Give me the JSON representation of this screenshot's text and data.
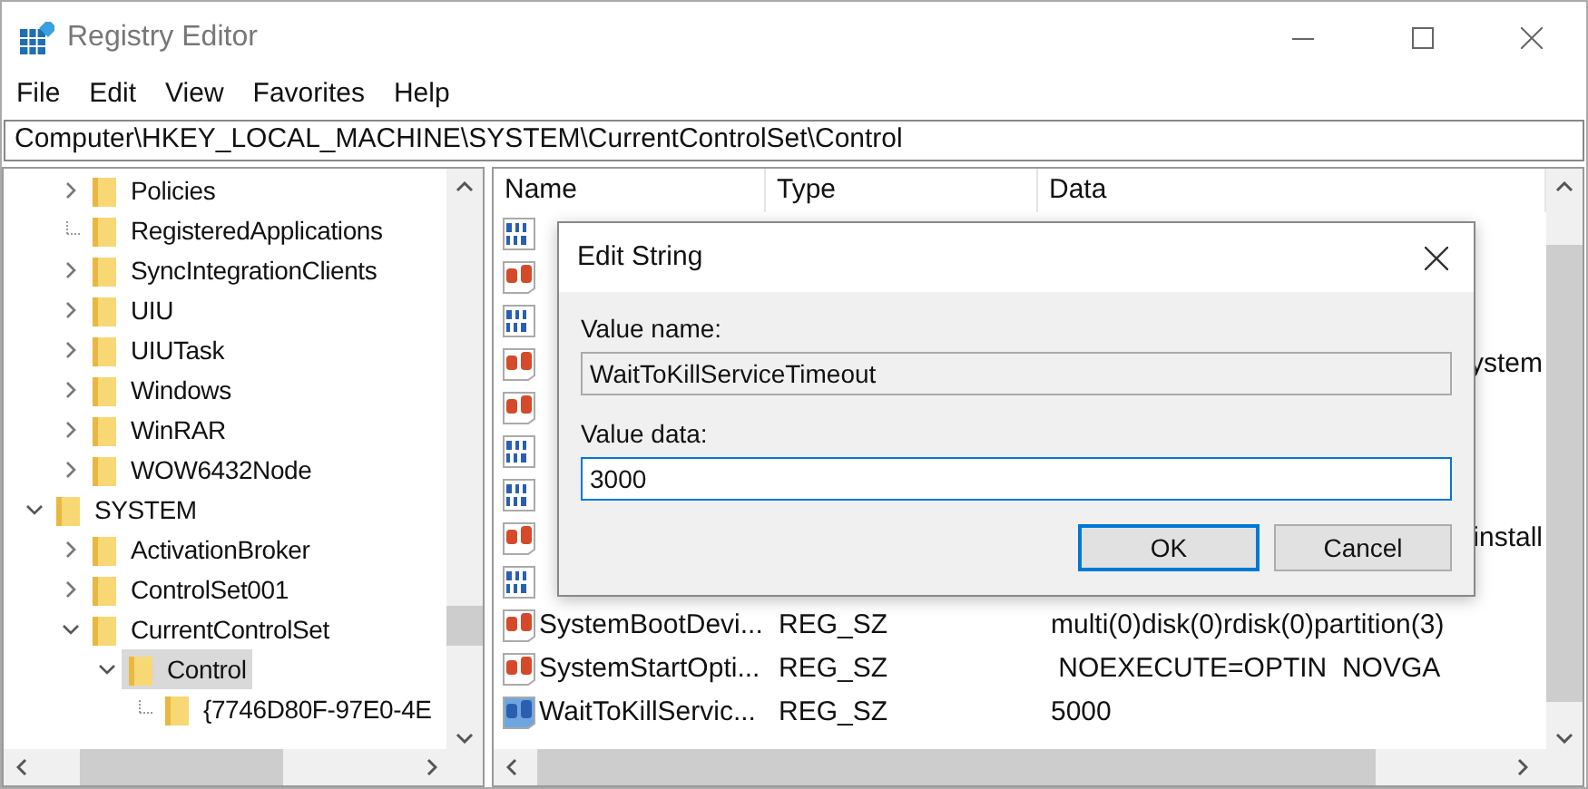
{
  "window": {
    "title": "Registry Editor"
  },
  "menu": [
    "File",
    "Edit",
    "View",
    "Favorites",
    "Help"
  ],
  "address": "Computer\\HKEY_LOCAL_MACHINE\\SYSTEM\\CurrentControlSet\\Control",
  "tree": {
    "continued_children": [
      {
        "label": "Policies",
        "has_children": true,
        "expanded": false,
        "selected": false
      },
      {
        "label": "RegisteredApplications",
        "has_children": false,
        "selected": false
      },
      {
        "label": "SyncIntegrationClients",
        "has_children": true,
        "expanded": false,
        "selected": false
      },
      {
        "label": "UIU",
        "has_children": true,
        "expanded": false,
        "selected": false
      },
      {
        "label": "UIUTask",
        "has_children": true,
        "expanded": false,
        "selected": false
      },
      {
        "label": "Windows",
        "has_children": true,
        "expanded": false,
        "selected": false
      },
      {
        "label": "WinRAR",
        "has_children": true,
        "expanded": false,
        "selected": false
      },
      {
        "label": "WOW6432Node",
        "has_children": true,
        "expanded": false,
        "selected": false
      }
    ],
    "nodes": [
      {
        "label": "SYSTEM",
        "has_children": true,
        "expanded": true,
        "selected": false,
        "children": [
          {
            "label": "ActivationBroker",
            "has_children": true,
            "expanded": false,
            "selected": false
          },
          {
            "label": "ControlSet001",
            "has_children": true,
            "expanded": false,
            "selected": false
          },
          {
            "label": "CurrentControlSet",
            "has_children": true,
            "expanded": true,
            "selected": false,
            "children": [
              {
                "label": "Control",
                "has_children": true,
                "expanded": true,
                "selected": true,
                "children": [
                  {
                    "label": "{7746D80F-97E0-4E",
                    "has_children": false,
                    "selected": false
                  }
                ]
              }
            ]
          }
        ]
      }
    ]
  },
  "list": {
    "columns": [
      "Name",
      "Type",
      "Data"
    ],
    "rows": [
      {
        "kind": "binary",
        "selected": false
      },
      {
        "kind": "string",
        "selected": false
      },
      {
        "kind": "binary",
        "selected": false
      },
      {
        "kind": "string",
        "selected": false,
        "data_tail": "ystem"
      },
      {
        "kind": "string",
        "selected": false
      },
      {
        "kind": "binary",
        "selected": false
      },
      {
        "kind": "binary",
        "selected": false
      },
      {
        "kind": "string",
        "selected": false,
        "data_tail": "install"
      },
      {
        "kind": "binary",
        "selected": false
      },
      {
        "kind": "string",
        "selected": false,
        "name": "SystemBootDevi...",
        "type": "REG_SZ",
        "data": "multi(0)disk(0)rdisk(0)partition(3)"
      },
      {
        "kind": "string",
        "selected": false,
        "name": "SystemStartOpti...",
        "type": "REG_SZ",
        "data": " NOEXECUTE=OPTIN  NOVGA"
      },
      {
        "kind": "string",
        "selected": true,
        "name": "WaitToKillServic...",
        "type": "REG_SZ",
        "data": "5000"
      }
    ]
  },
  "dialog": {
    "title": "Edit String",
    "value_name_label": "Value name:",
    "value_name": "WaitToKillServiceTimeout",
    "value_data_label": "Value data:",
    "value_data": "3000",
    "buttons": [
      {
        "label": "OK",
        "default": true
      },
      {
        "label": "Cancel",
        "default": false
      }
    ]
  }
}
